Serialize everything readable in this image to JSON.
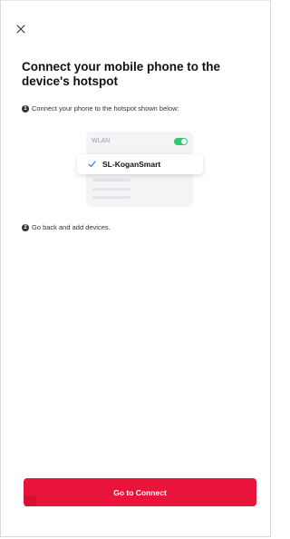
{
  "header": {
    "close_icon": "close-icon"
  },
  "title": "Connect your mobile phone to the device's hotspot",
  "steps": [
    {
      "number": "1",
      "text": "Connect your phone to the hotspot shown below:"
    },
    {
      "number": "2",
      "text": "Go back and add devices."
    }
  ],
  "illustration": {
    "wlan_label": "WLAN",
    "toggle_state": "on",
    "selected_ssid": "SL-KoganSmart",
    "check_icon": "check-icon"
  },
  "footer": {
    "connect_label": "Go to Connect"
  },
  "colors": {
    "accent": "#e8143c",
    "check": "#2a7de1",
    "toggle_on": "#2ec96c"
  }
}
